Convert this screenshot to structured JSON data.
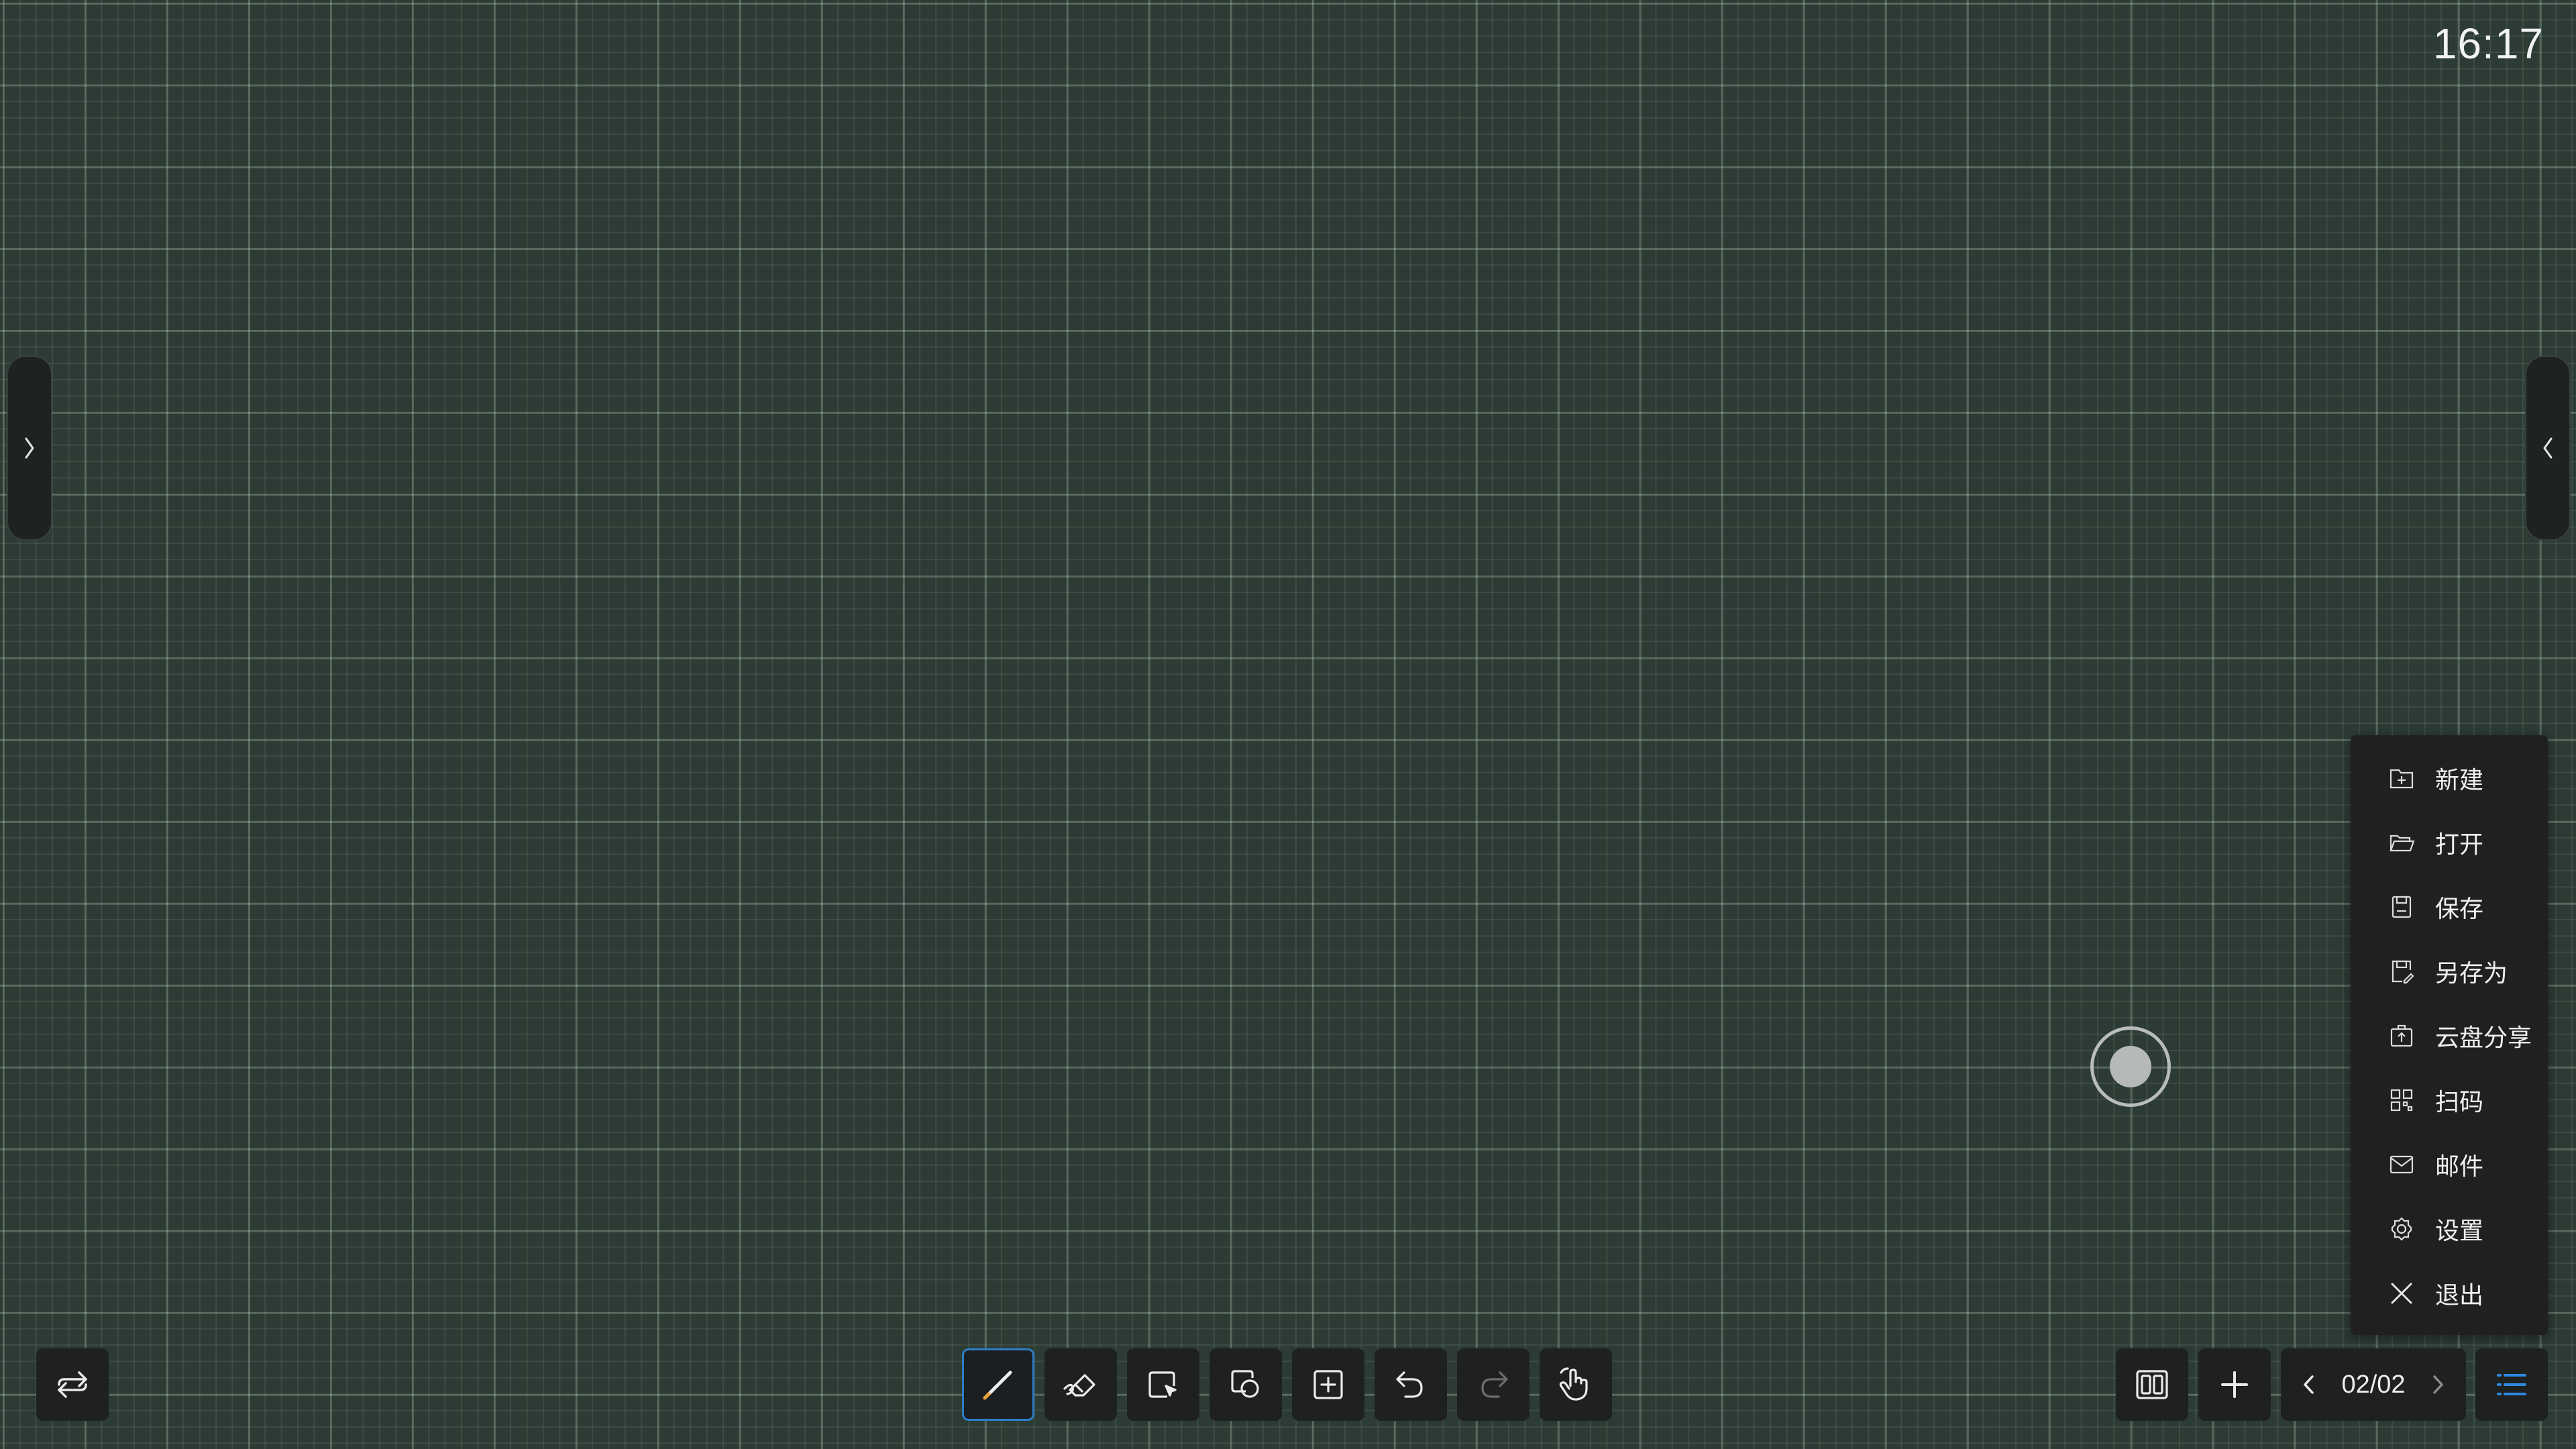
{
  "status": {
    "clock": "16:17"
  },
  "side_handles": {
    "left_icon": "chevron-right-icon",
    "right_icon": "chevron-left-icon"
  },
  "menu": {
    "items": [
      {
        "label": "新建",
        "icon": "new-file-icon"
      },
      {
        "label": "打开",
        "icon": "open-folder-icon"
      },
      {
        "label": "保存",
        "icon": "save-icon"
      },
      {
        "label": "另存为",
        "icon": "save-as-icon"
      },
      {
        "label": "云盘分享",
        "icon": "cloud-share-icon"
      },
      {
        "label": "扫码",
        "icon": "qr-code-icon"
      },
      {
        "label": "邮件",
        "icon": "mail-icon"
      },
      {
        "label": "设置",
        "icon": "settings-icon"
      },
      {
        "label": "退出",
        "icon": "close-icon"
      }
    ]
  },
  "toolbar": {
    "tools": [
      {
        "name": "pen",
        "icon": "pen-icon",
        "active": true
      },
      {
        "name": "eraser",
        "icon": "eraser-icon",
        "active": false
      },
      {
        "name": "select",
        "icon": "select-icon",
        "active": false
      },
      {
        "name": "shapes",
        "icon": "shapes-icon",
        "active": false
      },
      {
        "name": "insert",
        "icon": "insert-icon",
        "active": false
      },
      {
        "name": "undo",
        "icon": "undo-icon",
        "active": false
      },
      {
        "name": "redo",
        "icon": "redo-icon",
        "active": false
      },
      {
        "name": "pan",
        "icon": "hand-icon",
        "active": false
      }
    ]
  },
  "pager": {
    "current": "02/02"
  },
  "colors": {
    "board_background": "#2c3b34",
    "accent": "#2d7ec8",
    "toolbar_button": "#1f2120",
    "menu_background": "#202020"
  }
}
